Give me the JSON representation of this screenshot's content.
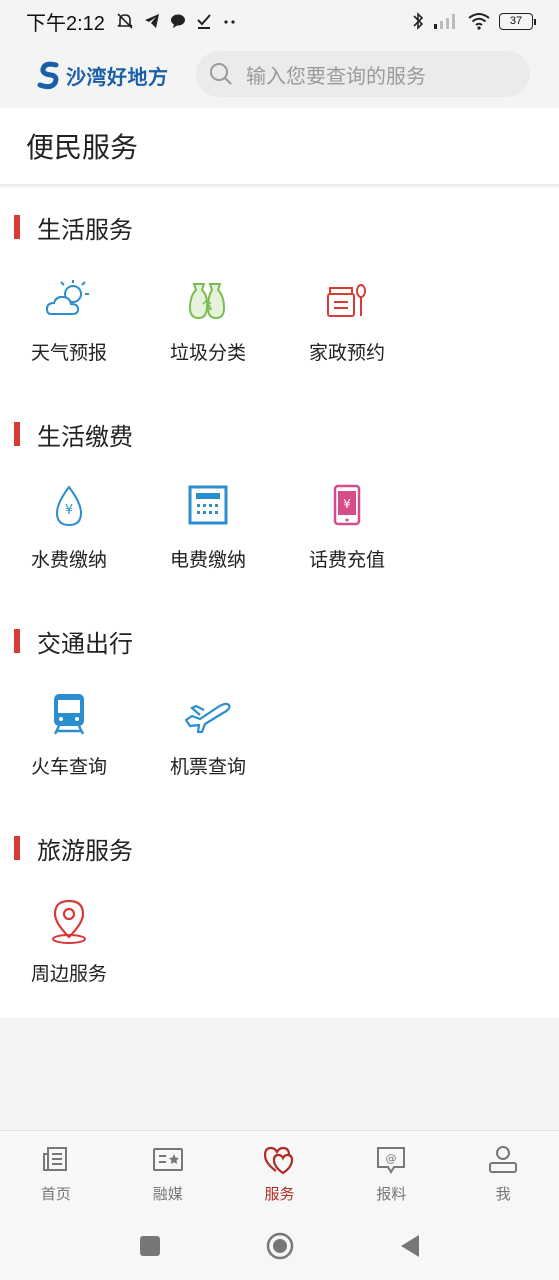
{
  "status": {
    "time": "下午2:12",
    "battery": "37"
  },
  "header": {
    "brand_name": "沙湾好地方",
    "search_placeholder": "输入您要查询的服务"
  },
  "page_title": "便民服务",
  "sections": [
    {
      "title": "生活服务",
      "items": [
        {
          "label": "天气预报",
          "icon": "weather-icon"
        },
        {
          "label": "垃圾分类",
          "icon": "garbage-sorting-icon"
        },
        {
          "label": "家政预约",
          "icon": "housekeeping-icon"
        }
      ]
    },
    {
      "title": "生活缴费",
      "items": [
        {
          "label": "水费缴纳",
          "icon": "water-bill-icon"
        },
        {
          "label": "电费缴纳",
          "icon": "electric-bill-icon"
        },
        {
          "label": "话费充值",
          "icon": "phone-recharge-icon"
        }
      ]
    },
    {
      "title": "交通出行",
      "items": [
        {
          "label": "火车查询",
          "icon": "train-icon"
        },
        {
          "label": "机票查询",
          "icon": "airplane-icon"
        }
      ]
    },
    {
      "title": "旅游服务",
      "items": [
        {
          "label": "周边服务",
          "icon": "location-pin-icon"
        }
      ]
    }
  ],
  "bottom_nav": [
    {
      "label": "首页",
      "icon": "home-news-icon"
    },
    {
      "label": "融媒",
      "icon": "media-icon"
    },
    {
      "label": "服务",
      "icon": "service-heart-icon",
      "active": true
    },
    {
      "label": "报料",
      "icon": "report-icon"
    },
    {
      "label": "我",
      "icon": "profile-icon"
    }
  ],
  "colors": {
    "accent": "#d83a35",
    "brand": "#1b5fa8",
    "active_nav": "#b22a24",
    "icon_blue": "#2a8ecf"
  }
}
